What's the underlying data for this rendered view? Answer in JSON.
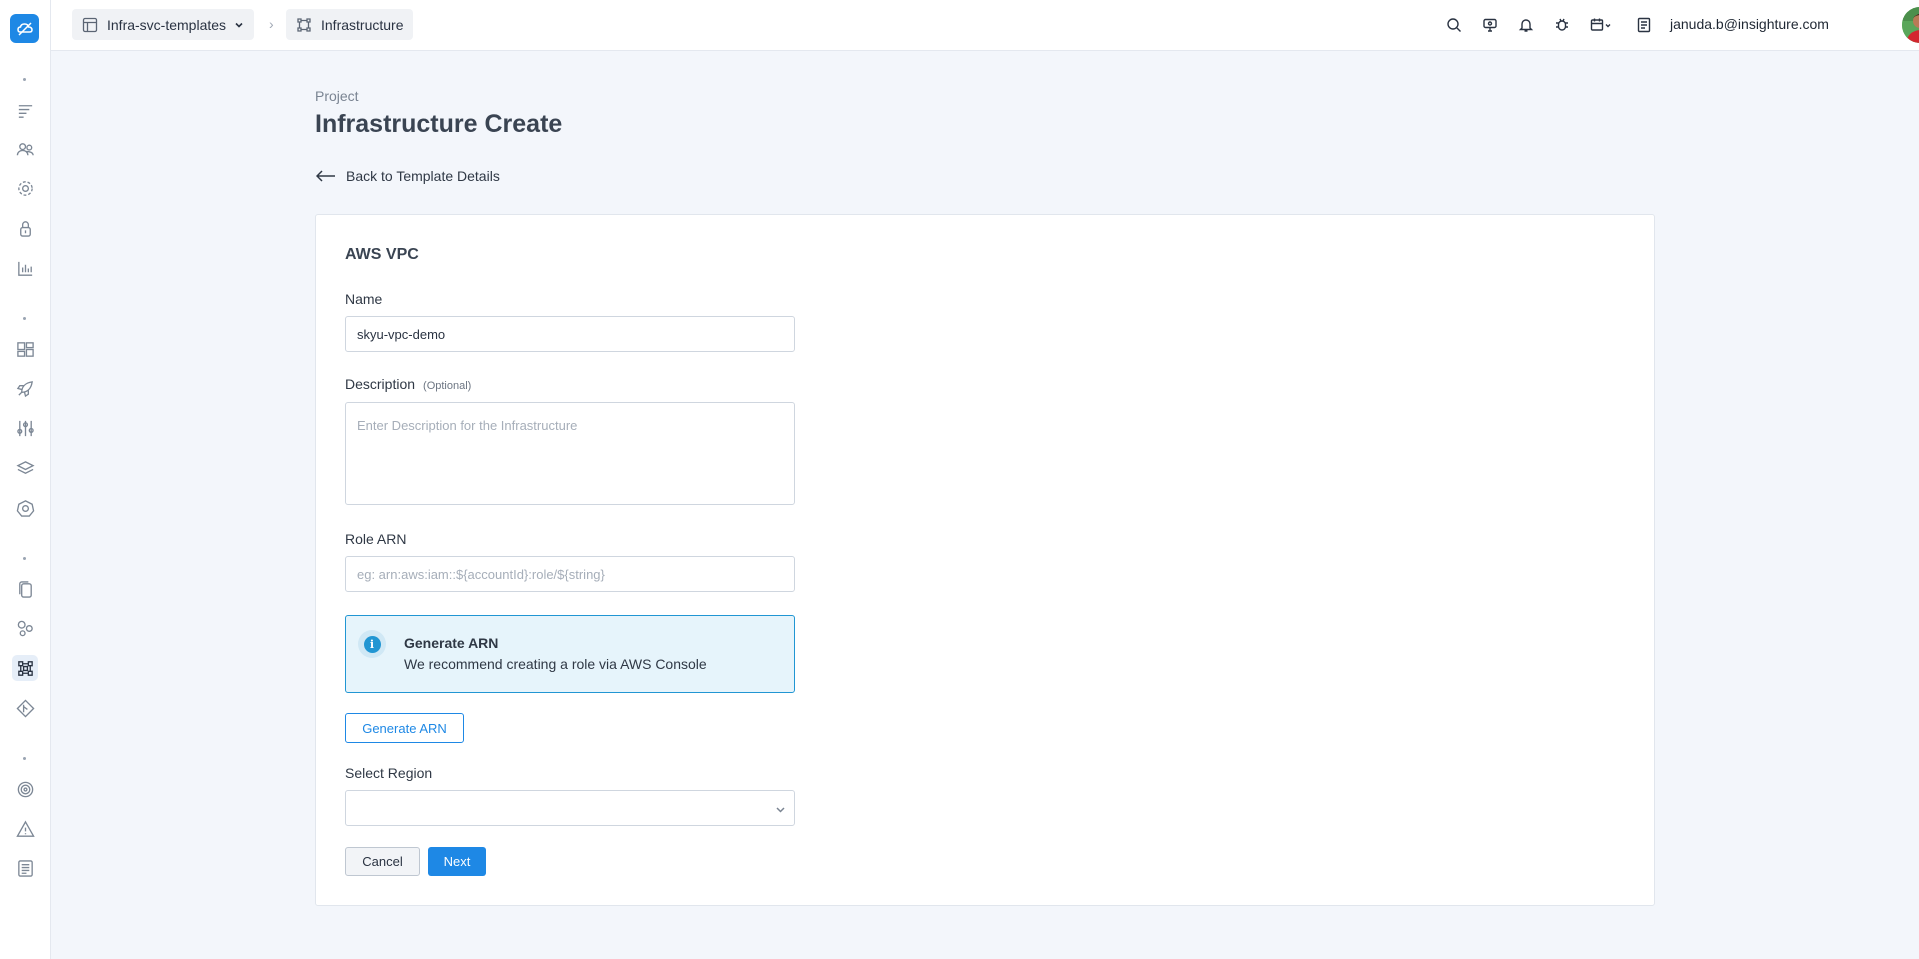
{
  "header": {
    "breadcrumb": [
      {
        "label": "Infra-svc-templates",
        "icon": "table-icon"
      },
      {
        "label": "Infrastructure",
        "icon": "infrastructure-icon"
      }
    ],
    "separator": "›",
    "user_email": "januda.b@insighture.com"
  },
  "page": {
    "label": "Project",
    "title": "Infrastructure Create",
    "back_link": "Back to Template Details"
  },
  "form": {
    "title": "AWS VPC",
    "name_label": "Name",
    "name_value": "skyu-vpc-demo",
    "description_label": "Description",
    "description_optional": "(Optional)",
    "description_placeholder": "Enter Description for the Infrastructure",
    "role_arn_label": "Role ARN",
    "role_arn_placeholder": "eg: arn:aws:iam::${accountId}:role/${string}",
    "info_title": "Generate ARN",
    "info_text": "We recommend creating a role via AWS Console",
    "generate_button": "Generate ARN",
    "region_label": "Select Region",
    "region_value": "",
    "cancel_button": "Cancel",
    "next_button": "Next"
  },
  "colors": {
    "accent": "#1e88e5",
    "background": "#f3f6fb",
    "info_bg": "#e6f4fb"
  }
}
